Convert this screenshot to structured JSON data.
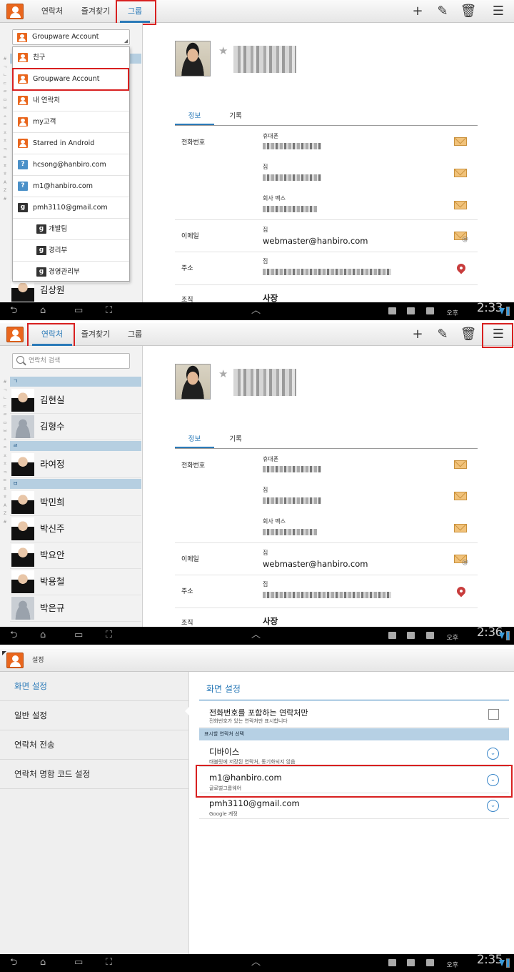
{
  "tabs": {
    "contacts": "연락처",
    "favorites": "즐겨찾기",
    "groups": "그룹"
  },
  "shot1": {
    "spinner_value": "Groupware Account",
    "groups": [
      {
        "label": "친구",
        "icon": "account"
      },
      {
        "label": "Groupware Account",
        "icon": "account"
      },
      {
        "label": "내 연락처",
        "icon": "account"
      },
      {
        "label": "my고객",
        "icon": "account"
      },
      {
        "label": "Starred in Android",
        "icon": "account"
      },
      {
        "label": "hcsong@hanbiro.com",
        "icon": "question"
      },
      {
        "label": "m1@hanbiro.com",
        "icon": "question"
      },
      {
        "label": "pmh3110@gmail.com",
        "icon": "google"
      },
      {
        "label": "개발팀",
        "icon": "google"
      },
      {
        "label": "경리부",
        "icon": "google"
      },
      {
        "label": "경영관리부",
        "icon": "google"
      }
    ],
    "bottom_contact": "김상원",
    "clock": "2:33"
  },
  "shot2": {
    "search_placeholder": "연락처 검색",
    "sections": [
      "ㄱ",
      "ㄹ",
      "ㅂ"
    ],
    "contacts": [
      "김현실",
      "김형수",
      "라여정",
      "박민희",
      "박신주",
      "박요안",
      "박용철",
      "박은규"
    ],
    "clock": "2:36"
  },
  "index_letters": [
    "#",
    "ㄱ",
    "ㄴ",
    "ㄷ",
    "ㄹ",
    "ㅁ",
    "ㅂ",
    "ㅅ",
    "ㅇ",
    "ㅈ",
    "ㅊ",
    "ㅋ",
    "ㅌ",
    "ㅍ",
    "ㅎ",
    "A",
    "Z",
    "#"
  ],
  "detail": {
    "tab_info": "정보",
    "tab_history": "기록",
    "phone_label": "전화번호",
    "mobile": "휴대폰",
    "home": "집",
    "work_fax": "회사 팩스",
    "email_label": "이메일",
    "email_type": "집",
    "email": "webmaster@hanbiro.com",
    "address_label": "주소",
    "address_type": "집",
    "org_label": "조직",
    "org_value": "사장"
  },
  "ampm": "오후",
  "shot3": {
    "title": "설정",
    "left_items": [
      "화면 설정",
      "일반 설정",
      "연락처 전송",
      "연락처 명함 코드 설정"
    ],
    "header": "화면 설정",
    "only_phone_title": "전화번호를 포함하는 연락처만",
    "only_phone_sub": "전화번호가 있는 연락처만 표시합니다",
    "section": "표시할 연락처 선택",
    "accounts": [
      {
        "title": "디바이스",
        "sub": "태블릿에 저장된 연락처, 동기화되지 않음"
      },
      {
        "title": "m1@hanbiro.com",
        "sub": "글로벌그룹웨어"
      },
      {
        "title": "pmh3110@gmail.com",
        "sub": "Google 계정"
      }
    ],
    "clock": "2:35"
  },
  "colors": {
    "accent": "#2a7ab8",
    "highlight_box": "#d82020",
    "app_icon": "#e9661d"
  }
}
